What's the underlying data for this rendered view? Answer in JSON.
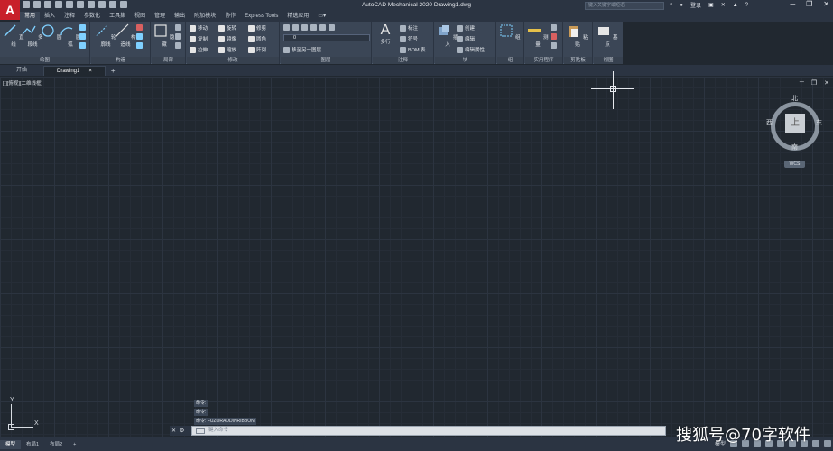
{
  "app": {
    "logo_letter": "A",
    "window_title": "AutoCAD Mechanical 2020    Drawing1.dwg",
    "search_placeholder": "键入关键字或短语",
    "login_label": "登录",
    "help_label": "?"
  },
  "ribbon_tabs": [
    "常用",
    "插入",
    "注释",
    "参数化",
    "工具集",
    "视图",
    "管理",
    "输出",
    "附加模块",
    "协作",
    "Express Tools",
    "精选应用"
  ],
  "ribbon": {
    "panels": {
      "draw": "绘图",
      "construct": "构造",
      "detail": "局部",
      "modify": "修改",
      "layers": "图层",
      "annotation": "注释",
      "block": "块",
      "group": "组",
      "utilities": "实用程序",
      "clipboard": "剪贴板",
      "view": "视图"
    },
    "tools": {
      "line": "直线",
      "polyline": "多段线",
      "circle": "圆",
      "arc": "圆弧",
      "construct_line": "构造线",
      "trace_line": "轮廓线",
      "trace_line2": "模式",
      "construct_line2": "线",
      "hide": "隐藏",
      "position": "位置",
      "move": "移动",
      "copy": "复制",
      "stretch": "拉伸",
      "rotate": "旋转",
      "mirror": "镜像",
      "scale": "缩放",
      "trim": "修剪",
      "fillet": "圆角",
      "array": "阵列",
      "layer_value": "0",
      "move_to_layer": "移至另一图层",
      "multiline_text": "多行",
      "multiline_text2": "文字",
      "dimension": "标注",
      "symbol": "符号",
      "bom": "BOM 表",
      "insert": "插入",
      "create": "创建",
      "edit": "编辑",
      "edit_attr": "编辑属性",
      "group": "组",
      "measure": "测量",
      "paste": "粘贴",
      "base": "基点"
    }
  },
  "doc_tabs": {
    "start": "开始",
    "drawing": "Drawing1",
    "close": "×",
    "add": "+"
  },
  "viewport": {
    "label": "[-][俯视][二维线框]",
    "ctrl_min": "─",
    "ctrl_restore": "❐",
    "ctrl_close": "✕"
  },
  "viewcube": {
    "north": "北",
    "south": "南",
    "east": "东",
    "west": "西",
    "top_face": "上",
    "wcs": "WCS"
  },
  "ucs": {
    "x": "X",
    "y": "Y"
  },
  "command": {
    "history": [
      "命令:",
      "命令:",
      "命令: FUZORADDINRIBBON"
    ],
    "placeholder": "键入命令"
  },
  "layout_tabs": [
    "模型",
    "布局1",
    "布局2",
    "+"
  ],
  "status": {
    "model_label": "模型"
  },
  "watermark": "搜狐号@70字软件",
  "colors": {
    "canvas": "#212830",
    "ribbon": "#3b4656",
    "logo": "#c8202a"
  }
}
